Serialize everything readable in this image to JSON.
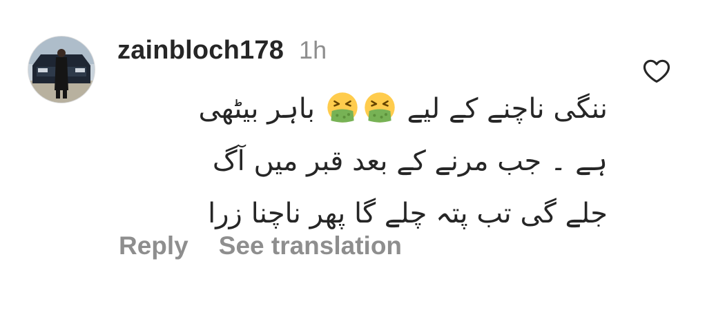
{
  "comment": {
    "username": "zainbloch178",
    "timestamp": "1h",
    "text_lines": [
      "ننگی ناچنے کے لیے",
      "باہر بیٹھی",
      "ہے ۔ جب مرنے کے بعد قبر میں آگ",
      "جلے گی تب پتہ چلے گا پھر ناچنا زرا"
    ],
    "emoji": "face-vomiting-emoji"
  },
  "actions": {
    "reply_label": "Reply",
    "translate_label": "See translation"
  },
  "icons": {
    "like": "heart-outline-icon",
    "avatar": "user-avatar"
  },
  "colors": {
    "text": "#262626",
    "secondary": "#8e8e8e",
    "emoji_face": "#ffcc4d",
    "emoji_vomit": "#77b255"
  }
}
